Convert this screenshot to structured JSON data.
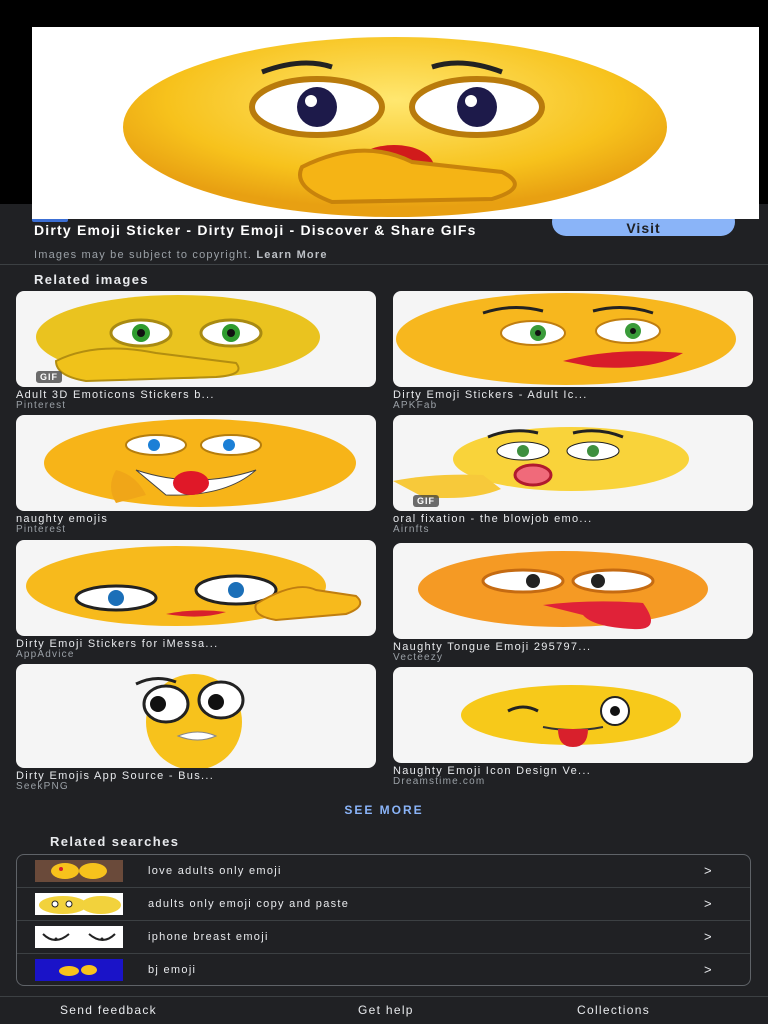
{
  "result": {
    "title": "Dirty Emoji Sticker - Dirty Emoji - Discover & Share GIFs",
    "visit_label": "Visit",
    "copyright_text": "Images may be subject to copyright.",
    "learn_more_label": "Learn More"
  },
  "related_images": {
    "heading": "Related images",
    "items": [
      {
        "caption": "Adult 3D Emoticons Stickers b...",
        "source": "Pinterest",
        "gif": "GIF"
      },
      {
        "caption": "Dirty Emoji Stickers - Adult Ic...",
        "source": "APKFab",
        "gif": ""
      },
      {
        "caption": "naughty emojis",
        "source": "Pinterest",
        "gif": ""
      },
      {
        "caption": "oral fixation - the blowjob emo...",
        "source": "Airnfts",
        "gif": "GIF"
      },
      {
        "caption": "Dirty Emoji Stickers for iMessa...",
        "source": "AppAdvice",
        "gif": ""
      },
      {
        "caption": "Naughty Tongue Emoji 295797...",
        "source": "Vecteezy",
        "gif": ""
      },
      {
        "caption": "Dirty Emojis App Source - Bus...",
        "source": "SeekPNG",
        "gif": ""
      },
      {
        "caption": "Naughty Emoji Icon Design Ve...",
        "source": "Dreamstime.com",
        "gif": ""
      }
    ],
    "see_more_label": "SEE MORE"
  },
  "related_searches": {
    "heading": "Related searches",
    "items": [
      {
        "label": "love adults only emoji",
        "chevron": ">"
      },
      {
        "label": "adults only emoji copy and paste",
        "chevron": ">"
      },
      {
        "label": "iphone breast emoji",
        "chevron": ">"
      },
      {
        "label": "bj emoji",
        "chevron": ">"
      }
    ]
  },
  "footer": {
    "send_feedback": "Send feedback",
    "get_help": "Get help",
    "collections": "Collections"
  },
  "colors": {
    "accent": "#8ab4f8",
    "sheet_bg": "#202124",
    "emoji_yellow": "#f7c21c"
  }
}
